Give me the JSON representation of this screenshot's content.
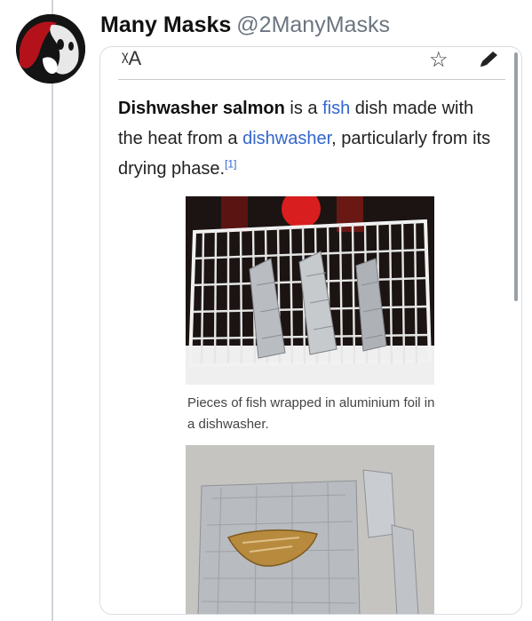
{
  "tweet": {
    "display_name": "Many Masks",
    "handle": "@2ManyMasks"
  },
  "icons": {
    "translate": "translate-icon",
    "star": "star-icon",
    "edit": "pencil-icon"
  },
  "toolbar": {
    "translate_glyph": "ᵡA",
    "star_glyph": "☆"
  },
  "article": {
    "title_bold": "Dishwasher salmon",
    "text_1": " is a ",
    "link_fish": "fish",
    "text_2": " dish made with the heat from a ",
    "link_dishwasher": "dishwasher",
    "text_3": ", particularly from its drying phase.",
    "ref": "[1]"
  },
  "figures": [
    {
      "caption": "Pieces of fish wrapped in aluminium foil in a dishwasher."
    },
    {
      "caption": ""
    }
  ],
  "colors": {
    "link": "#3366cc",
    "handle": "#6b7580"
  }
}
